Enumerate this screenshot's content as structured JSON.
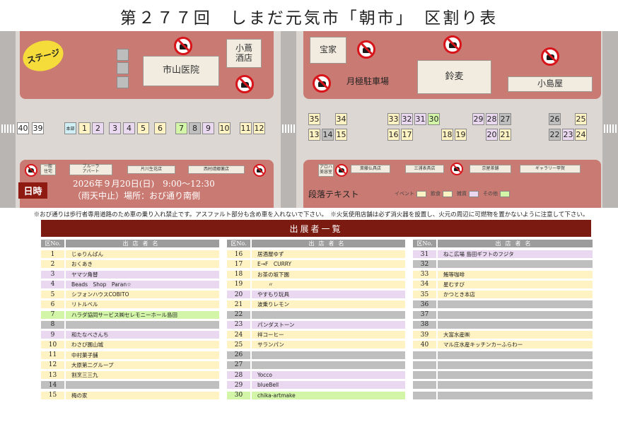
{
  "title": "第２７７回　しまだ元気市「朝市」　区割り表",
  "map": {
    "stage": "ステージ",
    "hospital": "市山医院",
    "sake": "小蔦\n酒店",
    "takaya": "宝家",
    "parking": "月極駐車場",
    "suzumugi": "鈴麦",
    "kojimaya": "小島屋",
    "bot_left": [
      "一般\n住宅",
      "ブルーラ\nアパート",
      "片川生花店",
      "西村靖郷薬店"
    ],
    "bot_right": [
      "アロハ\n美容室",
      "斎藤仏具店",
      "三浦表具店",
      "京屋茶舗",
      "ギャラリー甲賀"
    ],
    "date_badge": "日時",
    "date_line1": "2026年９月20日(日)　9:00～12:30",
    "date_line2": "（雨天中止）場所：おび通り南側",
    "section_text": "段落テキスト",
    "legend": [
      {
        "label": "イベント",
        "color": "#fff3c4"
      },
      {
        "label": "飲食",
        "color": "#fff3c4"
      },
      {
        "label": "雑貨",
        "color": "#ead8f0"
      },
      {
        "label": "その他",
        "color": "#d3f5a8"
      }
    ],
    "stalls_left": [
      {
        "n": "40",
        "t": "wh"
      },
      {
        "n": "39",
        "t": "wh"
      },
      {
        "n": "本部",
        "t": "hq"
      },
      {
        "n": "1",
        "t": "fd"
      },
      {
        "n": "2",
        "t": "gd"
      },
      {
        "n": "3",
        "t": "gd"
      },
      {
        "n": "4",
        "t": "gd"
      },
      {
        "n": "5",
        "t": "fd"
      },
      {
        "n": "6",
        "t": "fd"
      },
      {
        "n": "7",
        "t": "ot"
      },
      {
        "n": "8",
        "t": "gr"
      },
      {
        "n": "9",
        "t": "gd"
      },
      {
        "n": "10",
        "t": "fd"
      },
      {
        "n": "11",
        "t": "fd"
      },
      {
        "n": "12",
        "t": "fd"
      }
    ],
    "stalls_right_top": [
      {
        "n": "35",
        "t": "fd"
      },
      {
        "n": "34",
        "t": "fd"
      },
      {
        "n": "33",
        "t": "fd"
      },
      {
        "n": "32",
        "t": "gd"
      },
      {
        "n": "31",
        "t": "gd"
      },
      {
        "n": "30",
        "t": "ot"
      },
      {
        "n": "29",
        "t": "gd"
      },
      {
        "n": "28",
        "t": "gd"
      },
      {
        "n": "27",
        "t": "gr"
      },
      {
        "n": "26",
        "t": "gr"
      },
      {
        "n": "25",
        "t": "fd"
      }
    ],
    "stalls_right_bot": [
      {
        "n": "13",
        "t": "fd"
      },
      {
        "n": "14",
        "t": "gr"
      },
      {
        "n": "15",
        "t": "fd"
      },
      {
        "n": "16",
        "t": "fd"
      },
      {
        "n": "17",
        "t": "fd"
      },
      {
        "n": "18",
        "t": "fd"
      },
      {
        "n": "19",
        "t": "fd"
      },
      {
        "n": "20",
        "t": "gd"
      },
      {
        "n": "21",
        "t": "fd"
      },
      {
        "n": "22",
        "t": "gr"
      },
      {
        "n": "23",
        "t": "gd"
      },
      {
        "n": "24",
        "t": "fd"
      }
    ]
  },
  "notice": "※おび通りは歩行者専用道路のため車の乗り入れ禁止です。アスファルト部分も含め車を入れないで下さい。　※火気使用店舗は必ず消火器を設置し、火元の周辺に可燃物を置かないように注意して下さい。",
  "list": {
    "heading": "出展者一覧",
    "col_no": "区No.",
    "col_name": "出店者名",
    "columns": [
      [
        {
          "n": "1",
          "name": "じゅりんばん",
          "t": "fd"
        },
        {
          "n": "2",
          "name": "おくあき",
          "t": "fd"
        },
        {
          "n": "3",
          "name": "ヤマツ角替",
          "t": "gd"
        },
        {
          "n": "4",
          "name": "Beads　Shop　Paran☆",
          "t": "gd"
        },
        {
          "n": "5",
          "name": "シフォンハウスCOBITO",
          "t": "fd"
        },
        {
          "n": "6",
          "name": "リトルベル",
          "t": "fd"
        },
        {
          "n": "7",
          "name": "ハラダ協同サービス㈱セレモニーホール島田",
          "t": "ot"
        },
        {
          "n": "8",
          "name": "",
          "t": "gr"
        },
        {
          "n": "9",
          "name": "和たなべさんち",
          "t": "gd"
        },
        {
          "n": "10",
          "name": "わさび園山城",
          "t": "fd"
        },
        {
          "n": "11",
          "name": "中村菓子舗",
          "t": "fd"
        },
        {
          "n": "12",
          "name": "大原第二グループ",
          "t": "fd"
        },
        {
          "n": "13",
          "name": "割烹三三九",
          "t": "fd"
        },
        {
          "n": "14",
          "name": "",
          "t": "gr"
        },
        {
          "n": "15",
          "name": "梅の家",
          "t": "fd"
        }
      ],
      [
        {
          "n": "16",
          "name": "居酒屋ゆず",
          "t": "fd"
        },
        {
          "n": "17",
          "name": "E→F　CURRY",
          "t": "fd"
        },
        {
          "n": "18",
          "name": "お茶の坂下園",
          "t": "fd"
        },
        {
          "n": "19",
          "name": "　　〃",
          "t": "fd"
        },
        {
          "n": "20",
          "name": "やすもり玩具",
          "t": "gd"
        },
        {
          "n": "21",
          "name": "波乗りレモン",
          "t": "fd"
        },
        {
          "n": "22",
          "name": "",
          "t": "gr"
        },
        {
          "n": "23",
          "name": "パンダストーン",
          "t": "gd"
        },
        {
          "n": "24",
          "name": "祥コーヒー",
          "t": "fd"
        },
        {
          "n": "25",
          "name": "サランパン",
          "t": "fd"
        },
        {
          "n": "26",
          "name": "",
          "t": "gr"
        },
        {
          "n": "27",
          "name": "",
          "t": "gr"
        },
        {
          "n": "28",
          "name": "Yocco",
          "t": "gd"
        },
        {
          "n": "29",
          "name": "blueBell",
          "t": "gd"
        },
        {
          "n": "30",
          "name": "chika-artmake",
          "t": "ot"
        }
      ],
      [
        {
          "n": "31",
          "name": "ねこ広場 島田ギフトのフジタ",
          "t": "gd"
        },
        {
          "n": "32",
          "name": "",
          "t": "gr"
        },
        {
          "n": "33",
          "name": "鮪等咖啡",
          "t": "fd"
        },
        {
          "n": "34",
          "name": "星むすび",
          "t": "fd"
        },
        {
          "n": "35",
          "name": "かつとき本店",
          "t": "fd"
        },
        {
          "n": "36",
          "name": "",
          "t": "gr"
        },
        {
          "n": "37",
          "name": "",
          "t": "gr"
        },
        {
          "n": "38",
          "name": "",
          "t": "gr"
        },
        {
          "n": "39",
          "name": "大富水産㈱",
          "t": "fd"
        },
        {
          "n": "40",
          "name": "マル庄水産キッチンカーふらわー",
          "t": "fd"
        },
        {
          "n": "",
          "name": "",
          "t": "gr"
        },
        {
          "n": "",
          "name": "",
          "t": "gr"
        },
        {
          "n": "",
          "name": "",
          "t": "gr"
        },
        {
          "n": "",
          "name": "",
          "t": "gr"
        },
        {
          "n": "",
          "name": "",
          "t": "gr"
        }
      ]
    ]
  }
}
